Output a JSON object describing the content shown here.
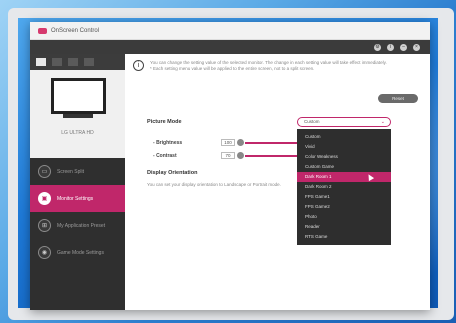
{
  "window": {
    "title": "OnScreen Control"
  },
  "sidebar": {
    "monitor_name": "LG ULTRA HD",
    "items": [
      {
        "label": "Screen Split",
        "icon": "screen-split-icon",
        "active": false
      },
      {
        "label": "Monitor Settings",
        "icon": "monitor-settings-icon",
        "active": true
      },
      {
        "label": "My Application Preset",
        "icon": "app-preset-icon",
        "active": false
      },
      {
        "label": "Game Mode Settings",
        "icon": "gamepad-icon",
        "active": false
      }
    ]
  },
  "main": {
    "info_text_1": "You can change the setting value of the selected monitor. The change in each setting value will take effect immediately.",
    "info_text_2": "* Each setting menu value will be applied to the entire screen, not to a split screen.",
    "reset_label": "Reset",
    "picture_mode_label": "Picture Mode",
    "picture_mode_value": "Custom",
    "brightness_label": "Brightness",
    "brightness_value": "100",
    "contrast_label": "Contrast",
    "contrast_value": "70",
    "display_orientation_label": "Display Orientation",
    "display_orientation_desc": "You can set your display orientation to Landscape or Portrait mode."
  },
  "picture_mode_options": [
    "Custom",
    "Vivid",
    "Color Weakness",
    "Custom Game",
    "Dark Room 1",
    "Dark Room 2",
    "FPS Game1",
    "FPS Game2",
    "Photo",
    "Reader",
    "RTS Game"
  ],
  "selected_option_index": 4,
  "colors": {
    "accent": "#c0276a",
    "sidebar_bg": "#2f2f2f"
  }
}
